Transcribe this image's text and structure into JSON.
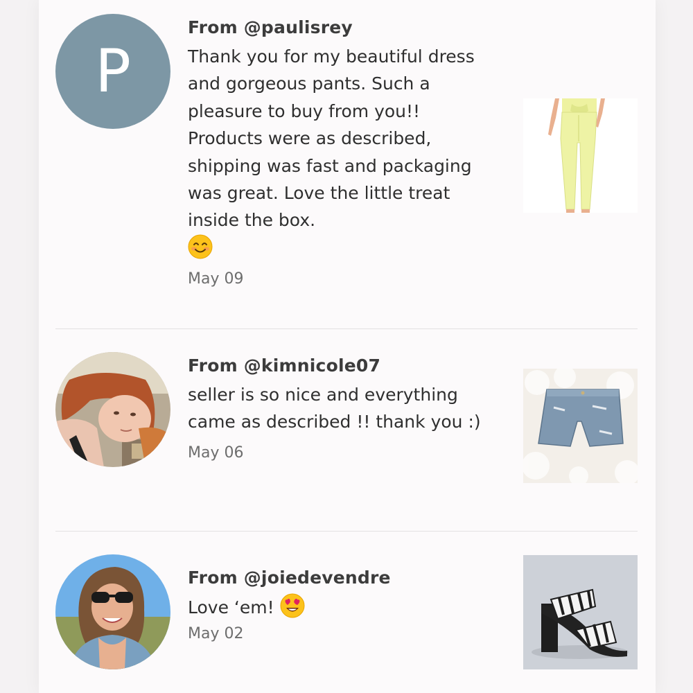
{
  "reviews": [
    {
      "from": "From @paulisrey",
      "avatar_letter": "P",
      "text": "Thank you for my beautiful dress and gorgeous pants. Such a pleasure to buy from you!! Products were as described, shipping was fast and packaging was great. Love the little treat inside the box.",
      "emoji": "smiling-face-icon",
      "date": "May 09",
      "thumbnail": "yellow-pants-photo"
    },
    {
      "from": "From @kimnicole07",
      "text": "seller is so nice and everything came as described !! thank you :)",
      "date": "May 06",
      "thumbnail": "denim-shorts-photo"
    },
    {
      "from": "From @joiedevendre",
      "text": "Love ‘em!",
      "emoji": "heart-eyes-icon",
      "date": "May 02",
      "thumbnail": "zebra-heels-photo"
    }
  ],
  "colors": {
    "avatar_letter_bg": "#7d97a5",
    "emoji_yellow": "#fcc21b",
    "heart_red": "#e0245e"
  }
}
